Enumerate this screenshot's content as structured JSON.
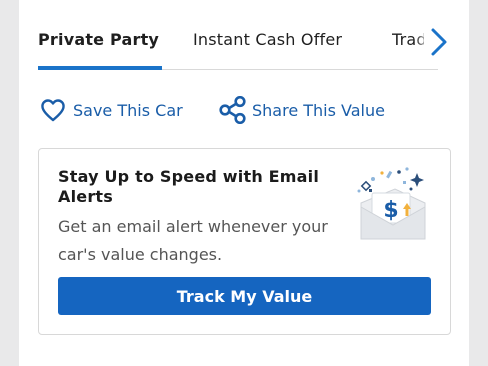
{
  "tabs": {
    "items": [
      {
        "label": "Private Party",
        "active": true
      },
      {
        "label": "Instant Cash Offer",
        "active": false
      },
      {
        "label": "Trade-In",
        "active": false
      }
    ],
    "next_icon": "chevron-right-icon"
  },
  "actions": {
    "save_label": "Save This Car",
    "save_icon": "heart-icon",
    "share_label": "Share This Value",
    "share_icon": "share-icon"
  },
  "email_alert": {
    "title": "Stay Up to Speed with Email Alerts",
    "body": "Get an email alert whenever your car's value changes.",
    "button_label": "Track My Value",
    "illustration_icon": "email-dollar-icon"
  },
  "colors": {
    "accent": "#1a73c9",
    "button": "#1565c0",
    "link": "#1a5da8"
  }
}
